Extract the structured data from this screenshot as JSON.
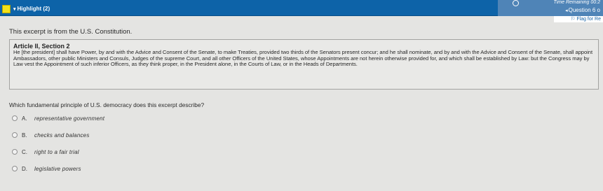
{
  "toolbar": {
    "highlight_label": "Highlight (2)",
    "time_remaining": "Time Remaining 00:2",
    "question_number": "Question 6 o",
    "flag_label": "Flag for Re",
    "colors": {
      "bar": "#0d63a8",
      "highlight_swatch": "#f2e21a"
    },
    "icons": {
      "highlight_caret": "caret-down-icon",
      "timer": "clock-icon",
      "question_caret": "caret-left-icon",
      "flag": "flag-icon"
    }
  },
  "passage": {
    "intro": "This excerpt is from the U.S. Constitution.",
    "title": "Article II, Section 2",
    "body": "He [the president] shall have Power, by and with the Advice and Consent of the Senate, to make Treaties, provided two thirds of the Senators present concur; and he shall nominate, and by and with the Advice and Consent of the Senate, shall appoint Ambassadors, other public Ministers and Consuls, Judges of the supreme Court, and all other Officers of the United States, whose Appointments are not herein otherwise provided for, and which shall be established by Law: but the Congress may by Law vest the Appointment of such inferior Officers, as they think proper, in the President alone, in the Courts of Law, or in the Heads of Departments."
  },
  "question": {
    "text": "Which fundamental principle of U.S. democracy does this excerpt describe?",
    "options": [
      {
        "letter": "A.",
        "text": "representative government"
      },
      {
        "letter": "B.",
        "text": "checks and balances"
      },
      {
        "letter": "C.",
        "text": "right to a fair trial"
      },
      {
        "letter": "D.",
        "text": "legislative powers"
      }
    ]
  }
}
